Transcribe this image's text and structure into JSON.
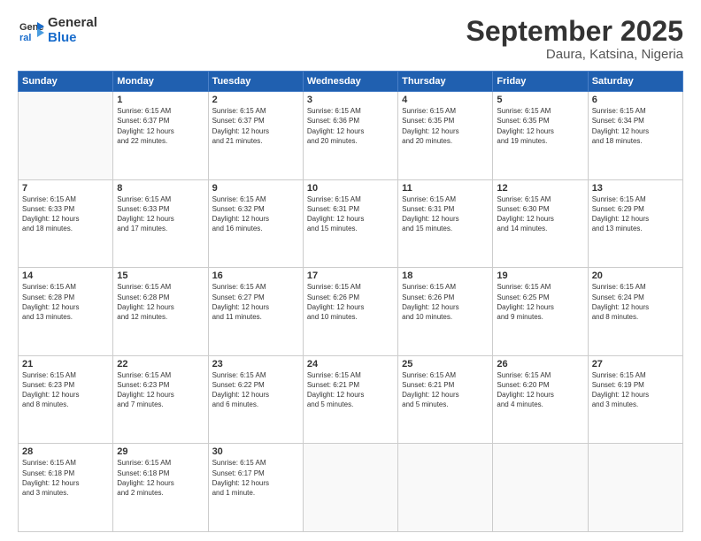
{
  "header": {
    "logo_general": "General",
    "logo_blue": "Blue",
    "month_title": "September 2025",
    "subtitle": "Daura, Katsina, Nigeria"
  },
  "weekdays": [
    "Sunday",
    "Monday",
    "Tuesday",
    "Wednesday",
    "Thursday",
    "Friday",
    "Saturday"
  ],
  "weeks": [
    [
      {
        "day": "",
        "info": ""
      },
      {
        "day": "1",
        "info": "Sunrise: 6:15 AM\nSunset: 6:37 PM\nDaylight: 12 hours\nand 22 minutes."
      },
      {
        "day": "2",
        "info": "Sunrise: 6:15 AM\nSunset: 6:37 PM\nDaylight: 12 hours\nand 21 minutes."
      },
      {
        "day": "3",
        "info": "Sunrise: 6:15 AM\nSunset: 6:36 PM\nDaylight: 12 hours\nand 20 minutes."
      },
      {
        "day": "4",
        "info": "Sunrise: 6:15 AM\nSunset: 6:35 PM\nDaylight: 12 hours\nand 20 minutes."
      },
      {
        "day": "5",
        "info": "Sunrise: 6:15 AM\nSunset: 6:35 PM\nDaylight: 12 hours\nand 19 minutes."
      },
      {
        "day": "6",
        "info": "Sunrise: 6:15 AM\nSunset: 6:34 PM\nDaylight: 12 hours\nand 18 minutes."
      }
    ],
    [
      {
        "day": "7",
        "info": "Sunrise: 6:15 AM\nSunset: 6:33 PM\nDaylight: 12 hours\nand 18 minutes."
      },
      {
        "day": "8",
        "info": "Sunrise: 6:15 AM\nSunset: 6:33 PM\nDaylight: 12 hours\nand 17 minutes."
      },
      {
        "day": "9",
        "info": "Sunrise: 6:15 AM\nSunset: 6:32 PM\nDaylight: 12 hours\nand 16 minutes."
      },
      {
        "day": "10",
        "info": "Sunrise: 6:15 AM\nSunset: 6:31 PM\nDaylight: 12 hours\nand 15 minutes."
      },
      {
        "day": "11",
        "info": "Sunrise: 6:15 AM\nSunset: 6:31 PM\nDaylight: 12 hours\nand 15 minutes."
      },
      {
        "day": "12",
        "info": "Sunrise: 6:15 AM\nSunset: 6:30 PM\nDaylight: 12 hours\nand 14 minutes."
      },
      {
        "day": "13",
        "info": "Sunrise: 6:15 AM\nSunset: 6:29 PM\nDaylight: 12 hours\nand 13 minutes."
      }
    ],
    [
      {
        "day": "14",
        "info": "Sunrise: 6:15 AM\nSunset: 6:28 PM\nDaylight: 12 hours\nand 13 minutes."
      },
      {
        "day": "15",
        "info": "Sunrise: 6:15 AM\nSunset: 6:28 PM\nDaylight: 12 hours\nand 12 minutes."
      },
      {
        "day": "16",
        "info": "Sunrise: 6:15 AM\nSunset: 6:27 PM\nDaylight: 12 hours\nand 11 minutes."
      },
      {
        "day": "17",
        "info": "Sunrise: 6:15 AM\nSunset: 6:26 PM\nDaylight: 12 hours\nand 10 minutes."
      },
      {
        "day": "18",
        "info": "Sunrise: 6:15 AM\nSunset: 6:26 PM\nDaylight: 12 hours\nand 10 minutes."
      },
      {
        "day": "19",
        "info": "Sunrise: 6:15 AM\nSunset: 6:25 PM\nDaylight: 12 hours\nand 9 minutes."
      },
      {
        "day": "20",
        "info": "Sunrise: 6:15 AM\nSunset: 6:24 PM\nDaylight: 12 hours\nand 8 minutes."
      }
    ],
    [
      {
        "day": "21",
        "info": "Sunrise: 6:15 AM\nSunset: 6:23 PM\nDaylight: 12 hours\nand 8 minutes."
      },
      {
        "day": "22",
        "info": "Sunrise: 6:15 AM\nSunset: 6:23 PM\nDaylight: 12 hours\nand 7 minutes."
      },
      {
        "day": "23",
        "info": "Sunrise: 6:15 AM\nSunset: 6:22 PM\nDaylight: 12 hours\nand 6 minutes."
      },
      {
        "day": "24",
        "info": "Sunrise: 6:15 AM\nSunset: 6:21 PM\nDaylight: 12 hours\nand 5 minutes."
      },
      {
        "day": "25",
        "info": "Sunrise: 6:15 AM\nSunset: 6:21 PM\nDaylight: 12 hours\nand 5 minutes."
      },
      {
        "day": "26",
        "info": "Sunrise: 6:15 AM\nSunset: 6:20 PM\nDaylight: 12 hours\nand 4 minutes."
      },
      {
        "day": "27",
        "info": "Sunrise: 6:15 AM\nSunset: 6:19 PM\nDaylight: 12 hours\nand 3 minutes."
      }
    ],
    [
      {
        "day": "28",
        "info": "Sunrise: 6:15 AM\nSunset: 6:18 PM\nDaylight: 12 hours\nand 3 minutes."
      },
      {
        "day": "29",
        "info": "Sunrise: 6:15 AM\nSunset: 6:18 PM\nDaylight: 12 hours\nand 2 minutes."
      },
      {
        "day": "30",
        "info": "Sunrise: 6:15 AM\nSunset: 6:17 PM\nDaylight: 12 hours\nand 1 minute."
      },
      {
        "day": "",
        "info": ""
      },
      {
        "day": "",
        "info": ""
      },
      {
        "day": "",
        "info": ""
      },
      {
        "day": "",
        "info": ""
      }
    ]
  ]
}
